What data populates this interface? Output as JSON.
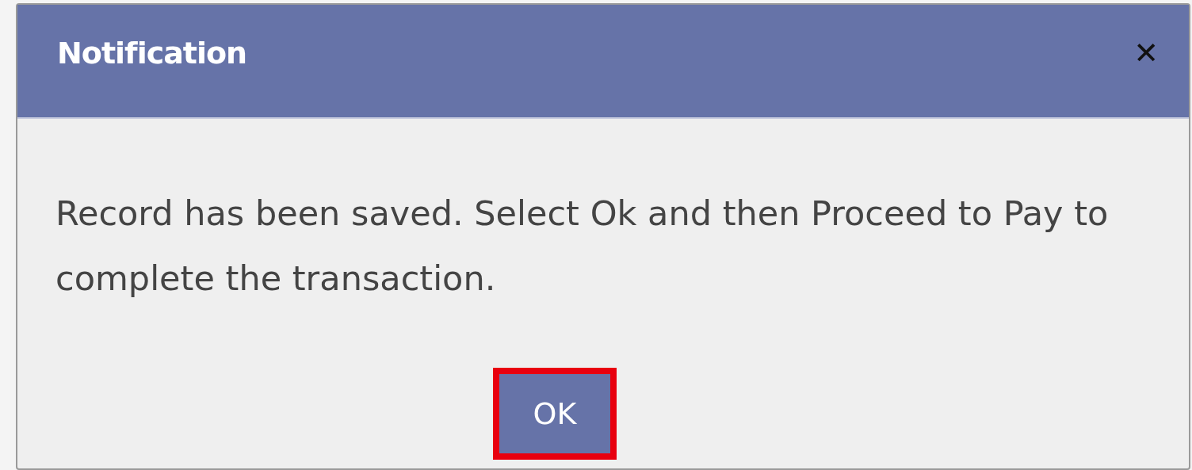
{
  "dialog": {
    "title": "Notification",
    "close": "✕",
    "message": "Record has been saved. Select Ok and then Proceed to Pay to complete the transaction.",
    "buttons": [
      {
        "label": "OK",
        "highlighted": true
      }
    ]
  }
}
